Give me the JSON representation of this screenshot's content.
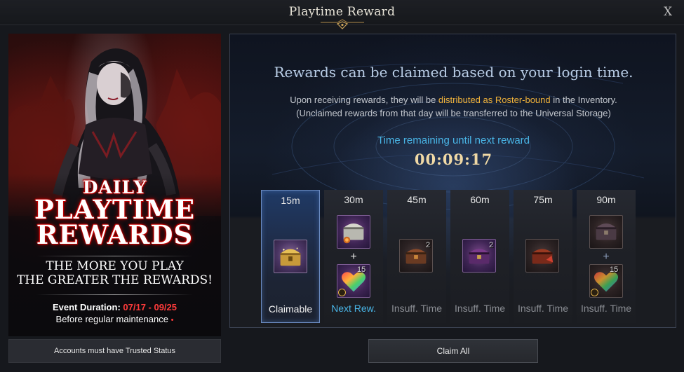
{
  "window": {
    "title": "Playtime Reward",
    "close_label": "X"
  },
  "banner": {
    "line1": "DAILY",
    "line2": "PLAYTIME",
    "line3": "REWARDS",
    "tagline1": "THE MORE YOU PLAY",
    "tagline2": "THE GREATER THE REWARDS!",
    "duration_label": "Event Duration: ",
    "duration_dates": "07/17 - 09/25",
    "maintenance_note": "Before regular maintenance",
    "maintenance_mark": "•"
  },
  "notice": {
    "trusted": "Accounts must have Trusted Status"
  },
  "panel": {
    "headline": "Rewards can be claimed based on your login time.",
    "info_prefix": "Upon receiving rewards, they will be ",
    "info_highlight": "distributed as Roster-bound",
    "info_suffix": " in the Inventory.",
    "info_line2": "(Unclaimed rewards from that day will be transferred to the Universal Storage)",
    "timer_label": "Time remaining until next reward",
    "timer_value": "00:09:17"
  },
  "slots": [
    {
      "time": "15m",
      "status": "Claimable"
    },
    {
      "time": "30m",
      "status": "Next Rew.",
      "item2_count": "15"
    },
    {
      "time": "45m",
      "status": "Insuff. Time",
      "item_count": "2"
    },
    {
      "time": "60m",
      "status": "Insuff. Time",
      "item_count": "2"
    },
    {
      "time": "75m",
      "status": "Insuff. Time"
    },
    {
      "time": "90m",
      "status": "Insuff. Time",
      "item2_count": "15"
    }
  ],
  "plus_sign": "+",
  "actions": {
    "claim_all": "Claim All"
  },
  "colors": {
    "accent_blue": "#49b5e6",
    "highlight_gold": "#f0b23a",
    "event_red": "#ff3b3b"
  }
}
